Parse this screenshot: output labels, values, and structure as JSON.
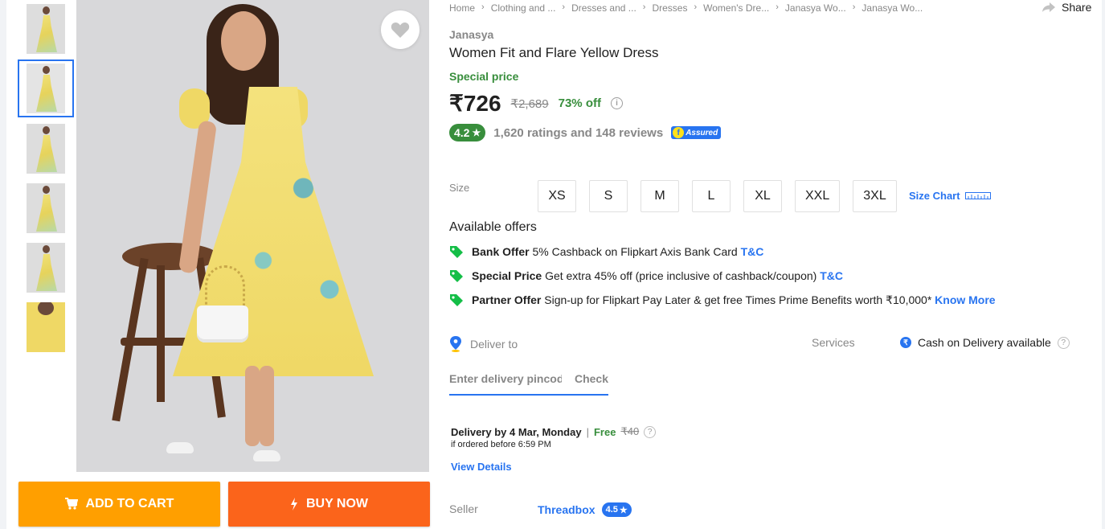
{
  "breadcrumb": [
    "Home",
    "Clothing and ...",
    "Dresses and ...",
    "Dresses",
    "Women's Dre...",
    "Janasya Wo...",
    "Janasya Wo..."
  ],
  "share_label": "Share",
  "product": {
    "brand": "Janasya",
    "title": "Women Fit and Flare Yellow Dress",
    "special_label": "Special price",
    "price": "₹726",
    "mrp": "₹2,689",
    "discount": "73% off",
    "rating": "4.2",
    "rating_star": "★",
    "ratings_reviews": "1,620 ratings and 148 reviews",
    "assured_label": "Assured"
  },
  "size": {
    "label": "Size",
    "options": [
      "XS",
      "S",
      "M",
      "L",
      "XL",
      "XXL",
      "3XL"
    ],
    "chart_label": "Size Chart"
  },
  "offers": {
    "title": "Available offers",
    "items": [
      {
        "type": "Bank Offer",
        "text": "5% Cashback on Flipkart Axis Bank Card",
        "link": "T&C"
      },
      {
        "type": "Special Price",
        "text": "Get extra 45% off (price inclusive of cashback/coupon)",
        "link": "T&C"
      },
      {
        "type": "Partner Offer",
        "text": "Sign-up for Flipkart Pay Later & get free Times Prime Benefits worth ₹10,000*",
        "link": "Know More"
      }
    ]
  },
  "delivery": {
    "deliver_to_label": "Deliver to",
    "pincode_placeholder": "Enter delivery pincode",
    "check_label": "Check",
    "delivery_by": "Delivery by 4 Mar, Monday",
    "separator": "|",
    "free_label": "Free",
    "fee_strike": "₹40",
    "ordered_before": "if ordered before 6:59 PM",
    "view_details": "View Details"
  },
  "services": {
    "label": "Services",
    "cod": "Cash on Delivery available",
    "cod_icon_glyph": "₹"
  },
  "seller": {
    "label": "Seller",
    "name": "Threadbox",
    "rating": "4.5",
    "rating_star": "★"
  },
  "actions": {
    "add_to_cart": "ADD TO CART",
    "buy_now": "BUY NOW"
  },
  "colors": {
    "primary": "#2874f0",
    "green": "#388e3c",
    "cart": "#ff9f00",
    "buy": "#fb641b",
    "muted": "#878787"
  },
  "icons": [
    "heart-icon",
    "share-icon",
    "cart-icon",
    "lightning-icon",
    "tag-icon",
    "location-pin-icon",
    "info-icon",
    "question-icon",
    "rupee-icon",
    "ruler-icon",
    "star-icon"
  ]
}
